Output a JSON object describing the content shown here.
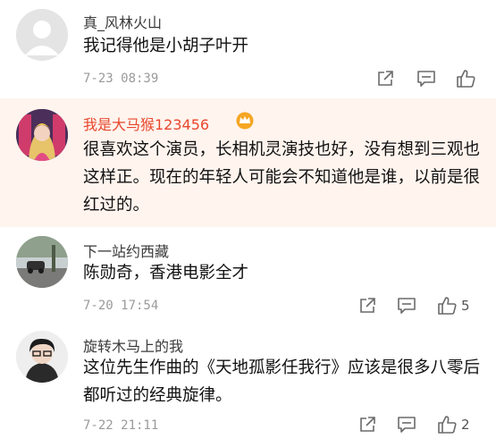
{
  "comments": [
    {
      "username": "真_风林火山",
      "text": "我记得他是小胡子叶开",
      "time": "7-23 08:39",
      "likes": ""
    },
    {
      "username": "我是大马猴123456",
      "text": "很喜欢这个演员，长相机灵演技也好，没有想到三观也这样正。现在的年轻人可能会不知道他是谁，以前是很红过的。",
      "time": "",
      "likes": ""
    },
    {
      "username": "下一站约西藏",
      "text": "陈勋奇，香港电影全才",
      "time": "7-20 17:54",
      "likes": "5"
    },
    {
      "username": "旋转木马上的我",
      "text": "这位先生作曲的《天地孤影任我行》应该是很多八零后都听过的经典旋律。",
      "time": "7-22 21:11",
      "likes": "2"
    }
  ],
  "icons": {
    "share": "share-icon",
    "comment": "comment-icon",
    "like": "thumbs-up-icon",
    "badge": "crown-badge-icon"
  },
  "colors": {
    "vip_name": "#e8482d",
    "highlight_bg": "#fff4ee",
    "meta_text": "#9a9a9a"
  }
}
